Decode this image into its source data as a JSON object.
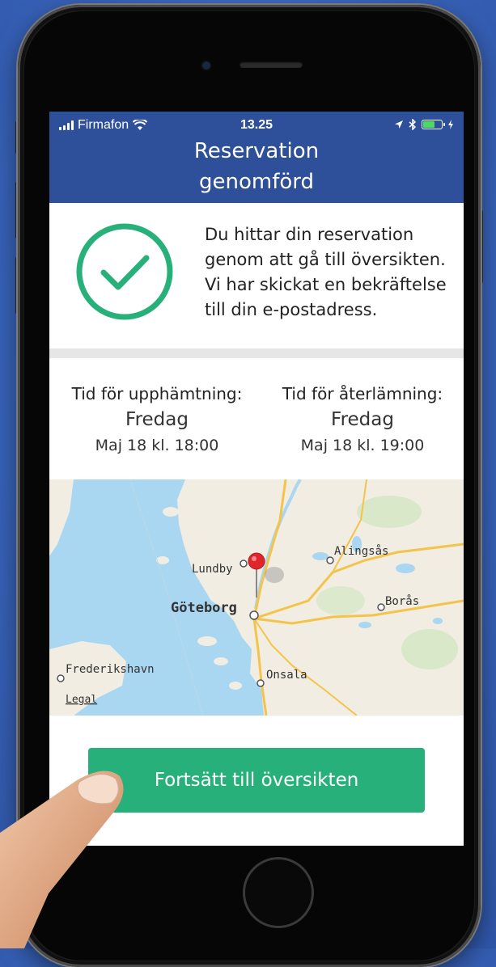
{
  "status_bar": {
    "carrier": "Firmafon",
    "time": "13.25"
  },
  "header": {
    "title_line1": "Reservation",
    "title_line2": "genomförd",
    "color": "#2e4f9a"
  },
  "confirmation": {
    "icon": "checkmark-circle-icon",
    "icon_color": "#27b07a",
    "message": "Du hittar din reservation genom att gå till översikten. Vi har skickat en bekräftelse till din e-postadress."
  },
  "pickup": {
    "label": "Tid för upphämtning:",
    "day": "Fredag",
    "date": "Maj 18 kl. 18:00"
  },
  "return": {
    "label": "Tid för återlämning:",
    "day": "Fredag",
    "date": "Maj 18 kl. 19:00"
  },
  "map": {
    "places": {
      "lundby": "Lundby",
      "goteborg": "Göteborg",
      "alingsas": "Alingsås",
      "boras": "Borås",
      "frederikshavn": "Frederikshavn",
      "onsala": "Onsala"
    },
    "legal": "Legal",
    "pin_color": "#e0262b"
  },
  "cta": {
    "label": "Fortsätt till översikten",
    "color": "#27b07a"
  }
}
